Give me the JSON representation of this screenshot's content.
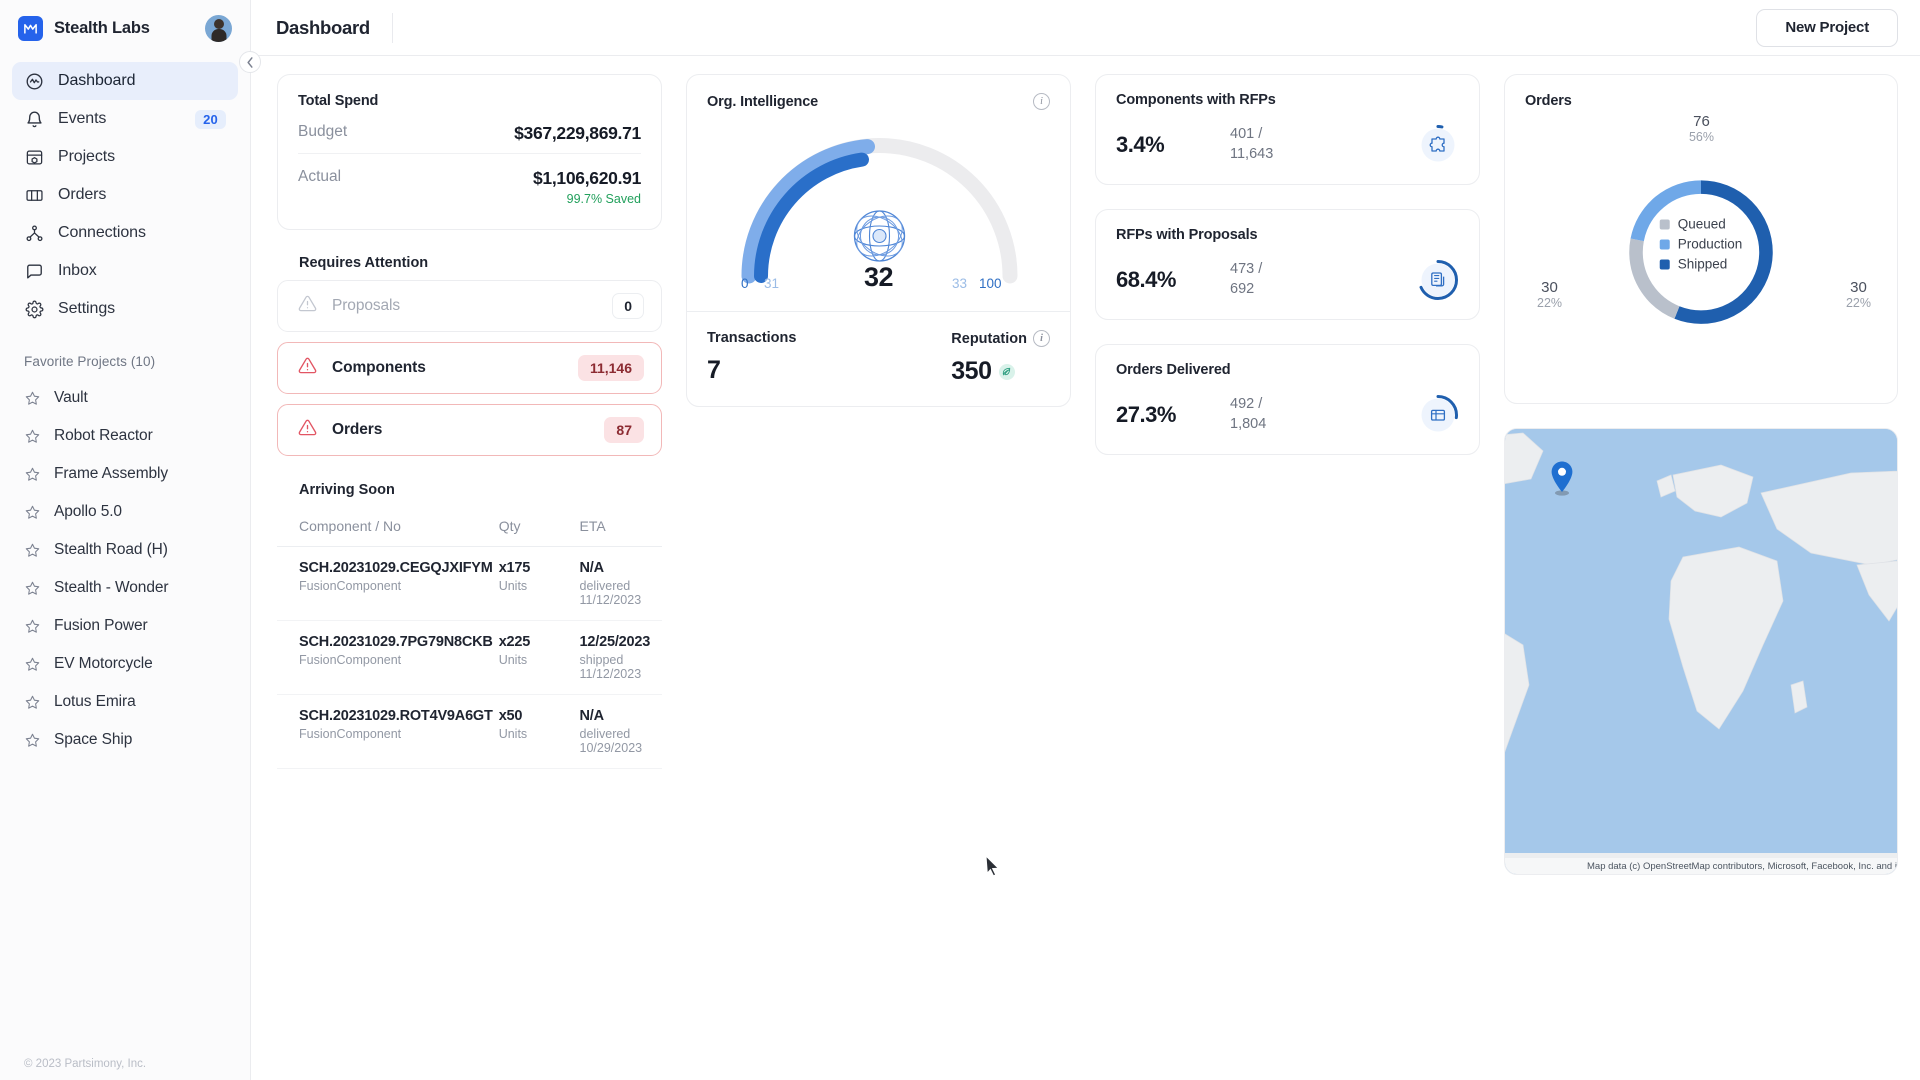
{
  "brand": {
    "name": "Stealth Labs",
    "logo_icon": "mail-logo-icon",
    "avatar_icon": "user-avatar"
  },
  "sidebar": {
    "collapse_icon": "chevron-left-icon",
    "items": [
      {
        "label": "Dashboard",
        "icon": "activity-icon",
        "badge": "",
        "active": true
      },
      {
        "label": "Events",
        "icon": "bell-icon",
        "badge": "20",
        "active": false
      },
      {
        "label": "Projects",
        "icon": "projects-icon",
        "badge": "",
        "active": false
      },
      {
        "label": "Orders",
        "icon": "orders-icon",
        "badge": "",
        "active": false
      },
      {
        "label": "Connections",
        "icon": "connections-icon",
        "badge": "",
        "active": false
      },
      {
        "label": "Inbox",
        "icon": "chat-icon",
        "badge": "",
        "active": false
      },
      {
        "label": "Settings",
        "icon": "gear-icon",
        "badge": "",
        "active": false
      }
    ],
    "favorites_title": "Favorite Projects (10)",
    "favorites": [
      {
        "label": "Vault"
      },
      {
        "label": "Robot Reactor"
      },
      {
        "label": "Frame Assembly"
      },
      {
        "label": "Apollo 5.0"
      },
      {
        "label": "Stealth Road (H)"
      },
      {
        "label": "Stealth - Wonder"
      },
      {
        "label": "Fusion Power"
      },
      {
        "label": "EV Motorcycle"
      },
      {
        "label": "Lotus Emira"
      },
      {
        "label": "Space Ship"
      }
    ],
    "footer": "© 2023 Partsimony, Inc."
  },
  "topbar": {
    "title": "Dashboard",
    "new_project_label": "New Project"
  },
  "total_spend": {
    "title": "Total Spend",
    "budget_label": "Budget",
    "budget_value": "$367,229,869.71",
    "actual_label": "Actual",
    "actual_value": "$1,106,620.91",
    "saved_note": "99.7% Saved",
    "saved_color": "#22a05c"
  },
  "requires_attention": {
    "title": "Requires Attention",
    "items": [
      {
        "label": "Proposals",
        "count": "0",
        "alert": false,
        "icon": "warning-icon"
      },
      {
        "label": "Components",
        "count": "11,146",
        "alert": true,
        "icon": "warning-icon"
      },
      {
        "label": "Orders",
        "count": "87",
        "alert": true,
        "icon": "warning-icon"
      }
    ]
  },
  "arriving_soon": {
    "title": "Arriving Soon",
    "columns": [
      "Component / No",
      "Qty",
      "ETA"
    ],
    "rows": [
      {
        "component": "SCH.20231029.CEGQJXIFYM",
        "component_sub": "FusionComponent",
        "qty": "x175",
        "qty_sub": "Units",
        "eta": "N/A",
        "eta_sub": "delivered 11/12/2023"
      },
      {
        "component": "SCH.20231029.7PG79N8CKB",
        "component_sub": "FusionComponent",
        "qty": "x225",
        "qty_sub": "Units",
        "eta": "12/25/2023",
        "eta_sub": "shipped 11/12/2023"
      },
      {
        "component": "SCH.20231029.ROT4V9A6GT",
        "component_sub": "FusionComponent",
        "qty": "x50",
        "qty_sub": "Units",
        "eta": "N/A",
        "eta_sub": "delivered 10/29/2023"
      }
    ]
  },
  "org_intelligence": {
    "title": "Org. Intelligence",
    "info_icon": "info-icon",
    "center_icon": "globe-sphere-icon",
    "transactions_label": "Transactions",
    "transactions_value": "7",
    "reputation_label": "Reputation",
    "reputation_value": "350",
    "reputation_icon": "leaf-badge-icon"
  },
  "metrics": [
    {
      "title": "Components with RFPs",
      "percent": "3.4%",
      "numerator": "401 /",
      "denominator": "11,643",
      "icon": "puzzle-piece-icon",
      "ring_pct": 3.4
    },
    {
      "title": "RFPs with Proposals",
      "percent": "68.4%",
      "numerator": "473 /",
      "denominator": "692",
      "icon": "document-copy-icon",
      "ring_pct": 68.4
    },
    {
      "title": "Orders Delivered",
      "percent": "27.3%",
      "numerator": "492 /",
      "denominator": "1,804",
      "icon": "package-icon",
      "ring_pct": 27.3
    }
  ],
  "orders_chart": {
    "title": "Orders"
  },
  "chart_data": {
    "type": "pie",
    "title": "Orders",
    "legend_position": "center",
    "labels": [
      "Queued",
      "Production",
      "Shipped"
    ],
    "values": [
      30,
      30,
      76
    ],
    "percents": [
      "22%",
      "22%",
      "56%"
    ],
    "colors": [
      "#b9c0cb",
      "#6fa8e8",
      "#1f5fae"
    ],
    "annotations": [
      {
        "label": "Shipped",
        "value": "76",
        "percent": "56%"
      },
      {
        "label": "Production",
        "value": "30",
        "percent": "22%"
      },
      {
        "label": "Queued",
        "value": "30",
        "percent": "22%"
      }
    ]
  },
  "gauge_data": {
    "type": "gauge",
    "title": "Org. Intelligence",
    "value": 32,
    "display_value": "32",
    "range": [
      0,
      100
    ],
    "ticks": [
      {
        "label": "0",
        "color": "#2f6fc4"
      },
      {
        "label": "31",
        "color": "#8fb4e0"
      },
      {
        "label": "33",
        "color": "#8fb4e0"
      },
      {
        "label": "100",
        "color": "#2f6fc4"
      }
    ],
    "segments": [
      {
        "name": "primary",
        "from": 0,
        "to": 31,
        "color": "#2a6fc9"
      },
      {
        "name": "secondary",
        "from": 31,
        "to": 33,
        "color": "#7fadea"
      },
      {
        "name": "track",
        "from": 33,
        "to": 100,
        "color": "#ececee"
      }
    ]
  },
  "map": {
    "attribution": "Map data (c) OpenStreetMap contributors, Microsoft, Facebook, Inc. and its affiliates, Esri Community Maps contributors, Map layer by Esri",
    "pin_icon": "location-pin-icon",
    "water_color": "#a5c8ea",
    "land_color": "#eceef0"
  }
}
